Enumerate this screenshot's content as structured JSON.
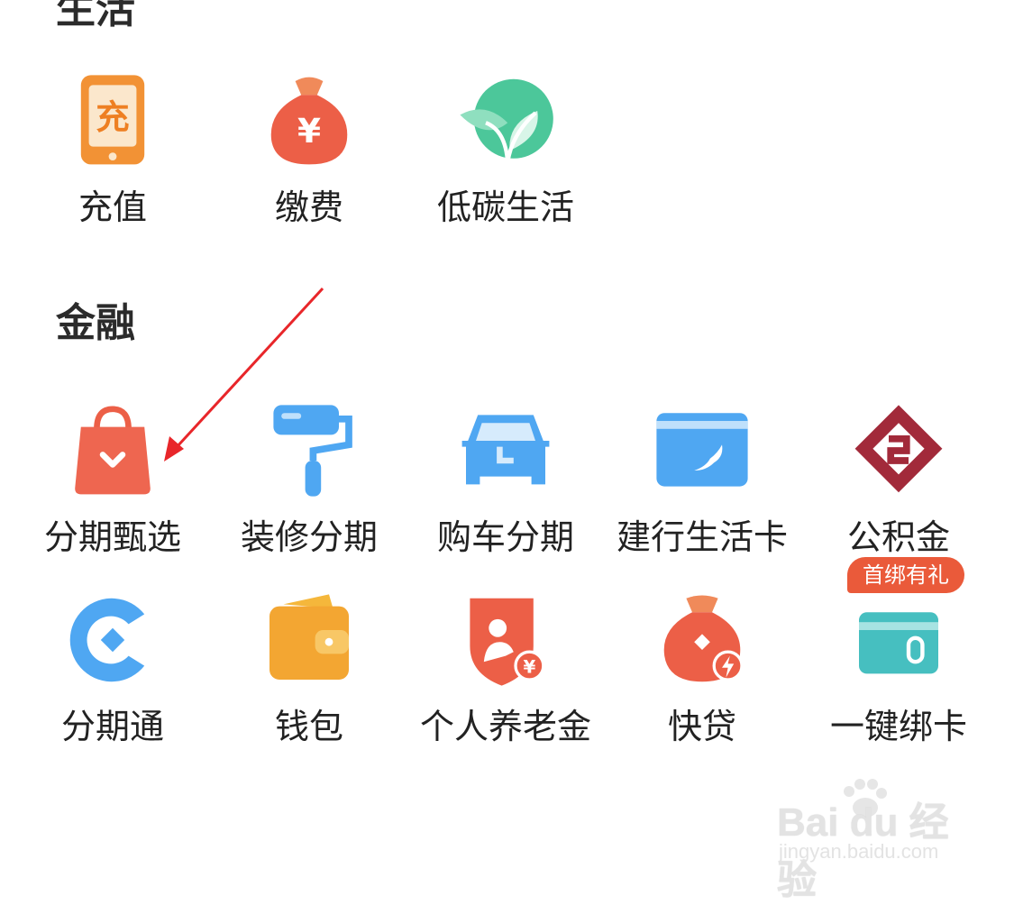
{
  "sections": {
    "life": {
      "title": "生活"
    },
    "finance": {
      "title": "金融"
    }
  },
  "life_items": [
    {
      "label": "充值",
      "icon": "recharge-phone-icon",
      "glyph": "充"
    },
    {
      "label": "缴费",
      "icon": "money-bag-icon",
      "glyph": "¥"
    },
    {
      "label": "低碳生活",
      "icon": "leaf-icon"
    }
  ],
  "finance_items": [
    {
      "label": "分期甄选",
      "icon": "shopping-bag-icon"
    },
    {
      "label": "装修分期",
      "icon": "paint-roller-icon"
    },
    {
      "label": "购车分期",
      "icon": "car-icon"
    },
    {
      "label": "建行生活卡",
      "icon": "card-icon"
    },
    {
      "label": "公积金",
      "icon": "housing-fund-icon"
    },
    {
      "label": "分期通",
      "icon": "c-logo-icon"
    },
    {
      "label": "钱包",
      "icon": "wallet-icon"
    },
    {
      "label": "个人养老金",
      "icon": "pension-shield-icon",
      "glyph": "¥"
    },
    {
      "label": "快贷",
      "icon": "fast-loan-bag-icon"
    },
    {
      "label": "一键绑卡",
      "icon": "bind-card-icon",
      "badge": "首绑有礼"
    }
  ],
  "watermark": {
    "brand": "Bai du 经验",
    "url": "jingyan.baidu.com"
  },
  "colors": {
    "orange": "#f0923b",
    "red": "#ec5f47",
    "green": "#4cc79a",
    "blue": "#4fa7f2",
    "maroon": "#a22a3a"
  }
}
